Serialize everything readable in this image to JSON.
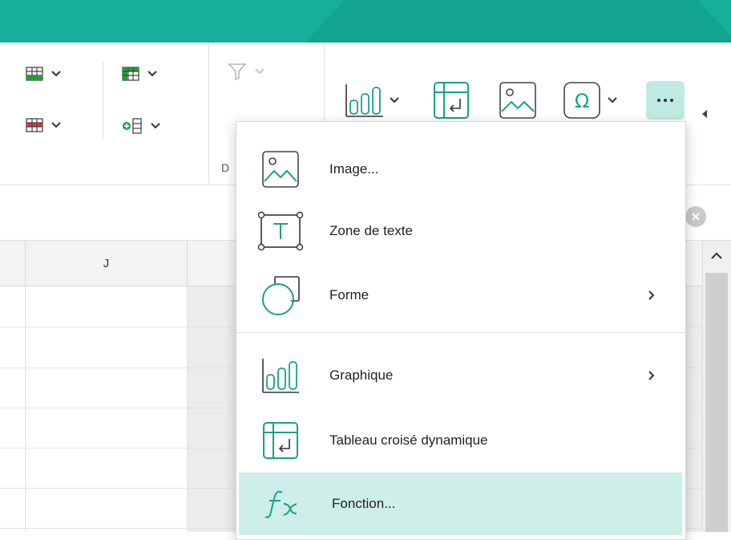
{
  "colors": {
    "accent": "#16b09a",
    "icon": "#1a9f8b",
    "hover": "#cdeee9"
  },
  "ribbon": {
    "group_label_partial": "D",
    "buttons": [
      {
        "name": "insert-cells-icon"
      },
      {
        "name": "delete-cells-icon"
      },
      {
        "name": "insert-table-icon"
      },
      {
        "name": "insert-column-icon"
      },
      {
        "name": "filter-icon"
      },
      {
        "name": "chart-icon"
      },
      {
        "name": "pivot-table-icon"
      },
      {
        "name": "image-icon"
      },
      {
        "name": "symbol-icon"
      },
      {
        "name": "more-options-icon"
      }
    ]
  },
  "grid": {
    "visible_column": "J"
  },
  "menu": {
    "items": [
      {
        "label": "Image...",
        "icon": "image-icon",
        "submenu": false
      },
      {
        "label": "Zone de texte",
        "icon": "text-box-icon",
        "submenu": false
      },
      {
        "label": "Forme",
        "icon": "shape-icon",
        "submenu": true
      },
      {
        "label": "Graphique",
        "icon": "chart-icon",
        "submenu": true
      },
      {
        "label": "Tableau croisé dynamique",
        "icon": "pivot-table-icon",
        "submenu": false
      },
      {
        "label": "Fonction...",
        "icon": "function-icon",
        "submenu": false,
        "highlighted": true
      }
    ]
  }
}
